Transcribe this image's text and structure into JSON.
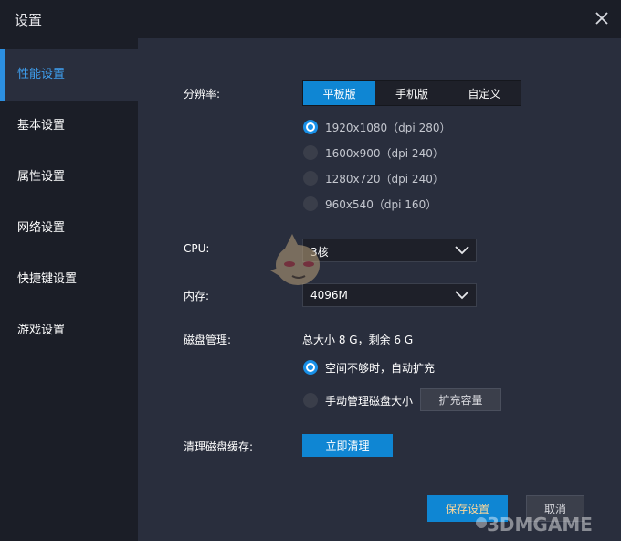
{
  "window": {
    "title": "设置"
  },
  "sidebar": {
    "items": [
      {
        "label": "性能设置",
        "active": true
      },
      {
        "label": "基本设置"
      },
      {
        "label": "属性设置"
      },
      {
        "label": "网络设置"
      },
      {
        "label": "快捷键设置"
      },
      {
        "label": "游戏设置"
      }
    ]
  },
  "resolution": {
    "label": "分辨率:",
    "tabs": [
      "平板版",
      "手机版",
      "自定义"
    ],
    "selected_tab": "平板版",
    "options": [
      "1920x1080（dpi 280）",
      "1600x900（dpi 240）",
      "1280x720（dpi 240）",
      "960x540（dpi 160）"
    ],
    "selected_option": "1920x1080（dpi 280）"
  },
  "cpu": {
    "label": "CPU:",
    "value": "3核"
  },
  "memory": {
    "label": "内存:",
    "value": "4096M"
  },
  "disk": {
    "label": "磁盘管理:",
    "summary": "总大小 8 G，剩余 6 G",
    "options": [
      "空间不够时，自动扩充",
      "手动管理磁盘大小"
    ],
    "selected_option": "空间不够时，自动扩充",
    "expand_button": "扩充容量"
  },
  "cache": {
    "label": "清理磁盘缓存:",
    "button": "立即清理"
  },
  "footer": {
    "save": "保存设置",
    "cancel": "取消"
  },
  "watermark": {
    "text": "3DMGAME"
  },
  "colors": {
    "accent": "#0f86d3",
    "panel": "#292e3d",
    "background": "#1b1e27"
  }
}
